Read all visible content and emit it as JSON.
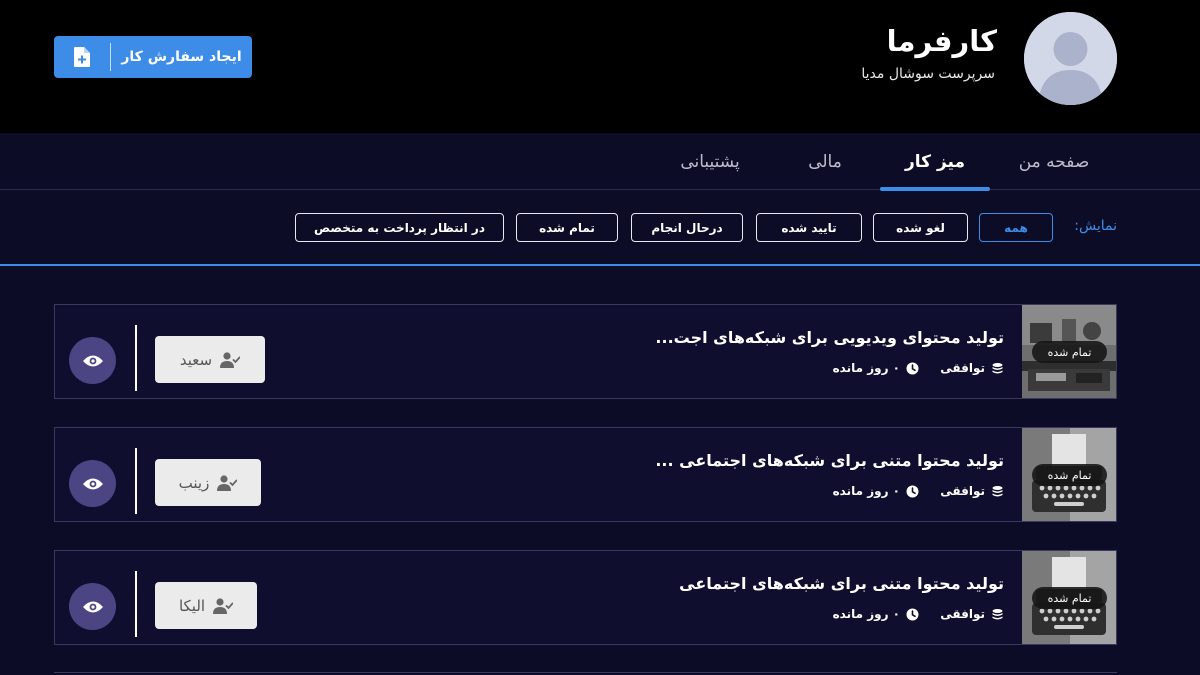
{
  "header": {
    "user_name": "کارفرما",
    "user_role": "سرپرست سوشال مدیا",
    "create_button_label": "ایجاد سفارش کار",
    "accent_color": "#3d8de8"
  },
  "tabs": [
    {
      "label": "صفحه من",
      "active": false
    },
    {
      "label": "میز کار",
      "active": true
    },
    {
      "label": "مالی",
      "active": false
    },
    {
      "label": "پشتیبانی",
      "active": false
    }
  ],
  "filters": {
    "label": "نمایش:",
    "options": [
      {
        "label": "همه",
        "active": true
      },
      {
        "label": "لغو شده",
        "active": false
      },
      {
        "label": "تایید شده",
        "active": false
      },
      {
        "label": "درحال انجام",
        "active": false
      },
      {
        "label": "تمام شده",
        "active": false
      },
      {
        "label": "در انتظار پرداخت به متخصص",
        "active": false
      }
    ]
  },
  "orders": [
    {
      "title": "تولید محتوای ویدیویی برای شبکه‌های اجت...",
      "status": "تمام شده",
      "price": "توافقی",
      "time_left": "۰ روز مانده",
      "assignee": "سعید",
      "thumb": "studio-photo"
    },
    {
      "title": "تولید محتوا متنی برای شبکه‌های اجتماعی ...",
      "status": "تمام شده",
      "price": "توافقی",
      "time_left": "۰ روز مانده",
      "assignee": "زینب",
      "thumb": "typewriter-photo"
    },
    {
      "title": "تولید محتوا متنی برای شبکه‌های اجتماعی",
      "status": "تمام شده",
      "price": "توافقی",
      "time_left": "۰ روز مانده",
      "assignee": "الیکا",
      "thumb": "typewriter-photo"
    }
  ],
  "icons": {
    "avatar": "user-silhouette-icon",
    "create": "file-plus-icon",
    "price": "coins-icon",
    "time": "clock-icon",
    "assignee": "user-check-icon",
    "view": "eye-icon"
  }
}
